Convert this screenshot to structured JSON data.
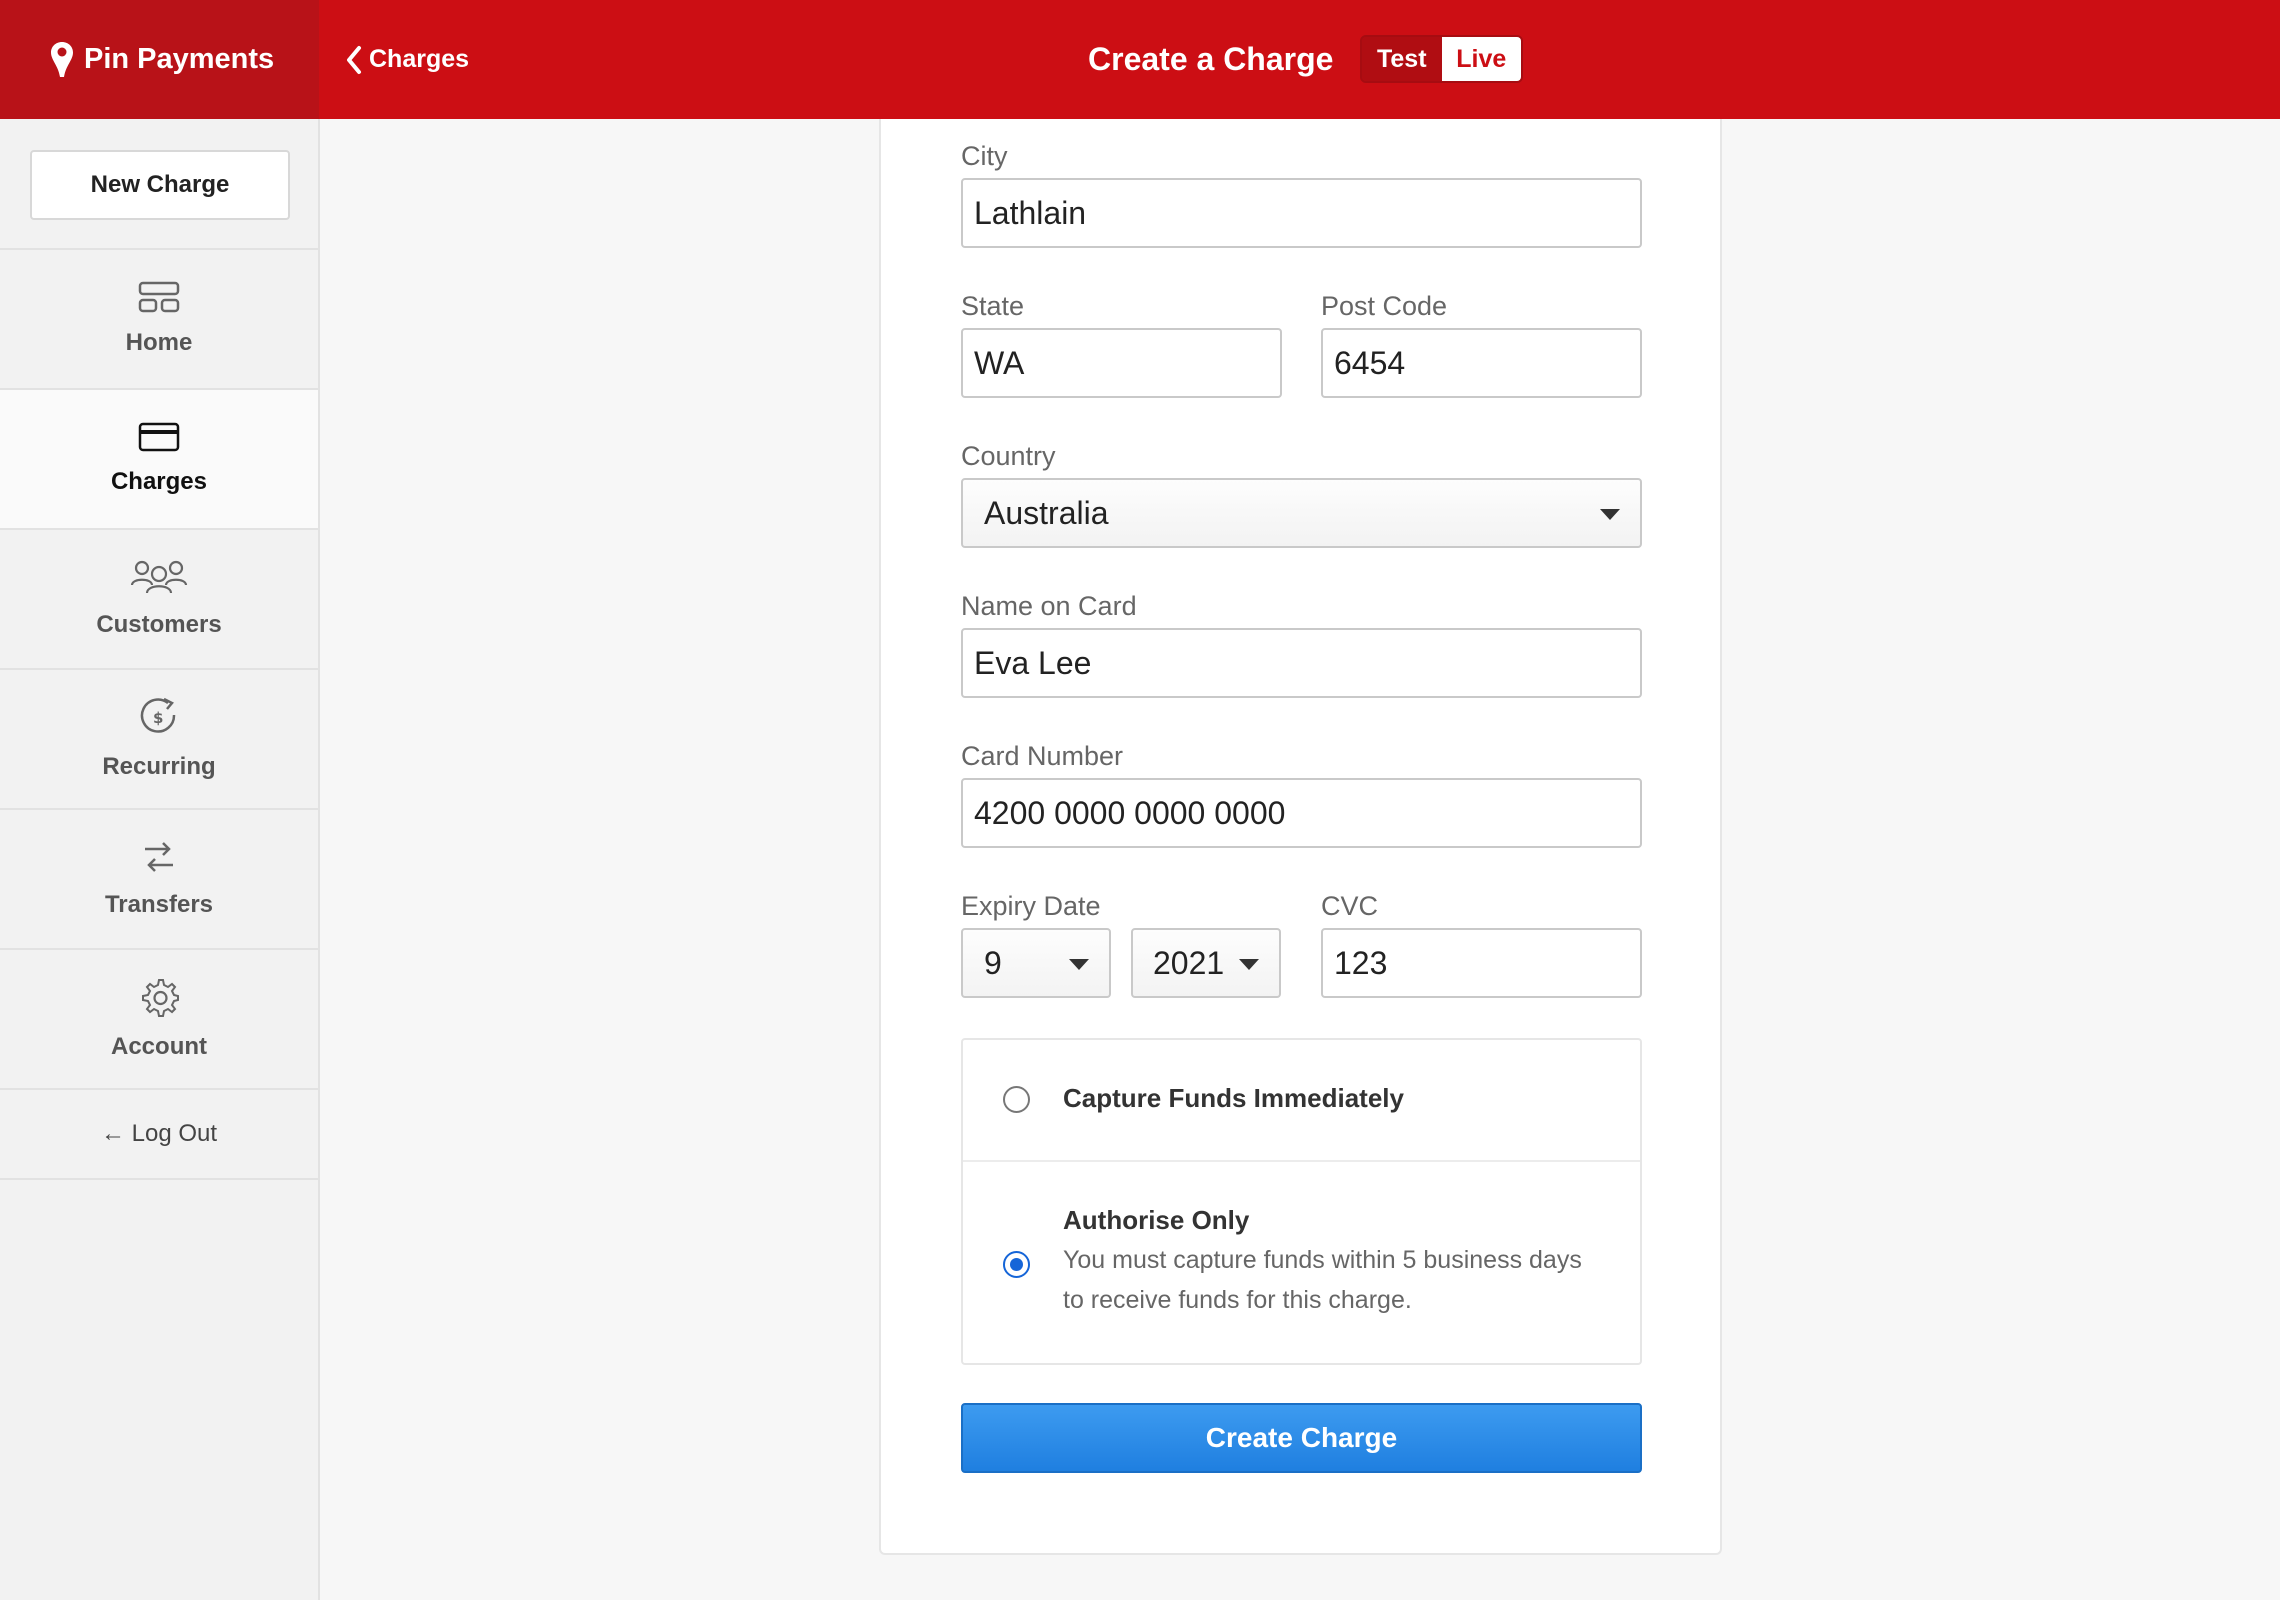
{
  "header": {
    "brand": "Pin Payments",
    "back_label": "Charges",
    "title": "Create a Charge",
    "mode_test": "Test",
    "mode_live": "Live",
    "brand_color": "#cc0e14"
  },
  "sidebar": {
    "new_charge": "New Charge",
    "items": [
      {
        "label": "Home",
        "icon": "home-icon"
      },
      {
        "label": "Charges",
        "icon": "credit-card-icon",
        "active": true
      },
      {
        "label": "Customers",
        "icon": "users-icon"
      },
      {
        "label": "Recurring",
        "icon": "recurring-icon"
      },
      {
        "label": "Transfers",
        "icon": "transfers-icon"
      },
      {
        "label": "Account",
        "icon": "gear-icon"
      }
    ],
    "logout": "← Log Out"
  },
  "form": {
    "city": {
      "label": "City",
      "value": "Lathlain"
    },
    "state": {
      "label": "State",
      "value": "WA"
    },
    "postcode": {
      "label": "Post Code",
      "value": "6454"
    },
    "country": {
      "label": "Country",
      "value": "Australia"
    },
    "name_on_card": {
      "label": "Name on Card",
      "value": "Eva Lee"
    },
    "card_number": {
      "label": "Card Number",
      "value": "4200 0000 0000 0000"
    },
    "expiry": {
      "label": "Expiry Date",
      "month": "9",
      "year": "2021"
    },
    "cvc": {
      "label": "CVC",
      "value": "123"
    },
    "capture_option": {
      "title": "Capture Funds Immediately",
      "selected": false
    },
    "authorise_option": {
      "title": "Authorise Only",
      "description": "You must capture funds within 5 business days to receive funds for this charge.",
      "selected": true
    },
    "submit": "Create Charge",
    "accent_color": "#1f7fe0"
  }
}
